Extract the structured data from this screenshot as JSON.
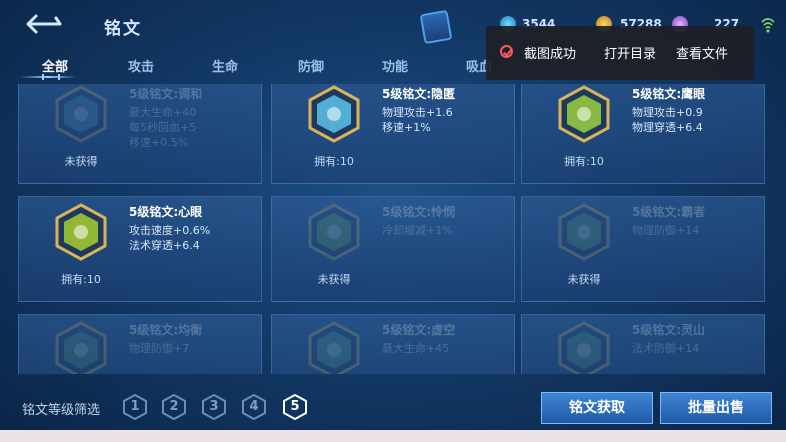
{
  "header": {
    "title": "铭文",
    "resources": {
      "gem": "3544",
      "gold": "57288",
      "crystal": "227"
    }
  },
  "tabs": [
    {
      "label": "全部",
      "active": true
    },
    {
      "label": "攻击"
    },
    {
      "label": "生命"
    },
    {
      "label": "防御"
    },
    {
      "label": "功能"
    },
    {
      "label": "吸血"
    }
  ],
  "toast": {
    "message": "截图成功",
    "open_dir": "打开目录",
    "view_file": "查看文件"
  },
  "cards": [
    {
      "name": "5级铭文:调和",
      "stats": [
        "最大生命+40",
        "每5秒回血+5",
        "移速+0.5%"
      ],
      "owned": "未获得",
      "acquired": false,
      "color": "#4fa0c8"
    },
    {
      "name": "5级铭文:隐匿",
      "stats": [
        "物理攻击+1.6",
        "移速+1%"
      ],
      "owned": "拥有:10",
      "acquired": true,
      "color": "#5cc4e8"
    },
    {
      "name": "5级铭文:鹰眼",
      "stats": [
        "物理攻击+0.9",
        "物理穿透+6.4"
      ],
      "owned": "拥有:10",
      "acquired": true,
      "color": "#9ccf3f"
    },
    {
      "name": "5级铭文:心眼",
      "stats": [
        "攻击速度+0.6%",
        "法术穿透+6.4"
      ],
      "owned": "拥有:10",
      "acquired": true,
      "color": "#a6cf2e"
    },
    {
      "name": "5级铭文:怜悯",
      "stats": [
        "冷却缩减+1%"
      ],
      "owned": "未获得",
      "acquired": false,
      "color": "#7fb84a"
    },
    {
      "name": "5级铭文:霸者",
      "stats": [
        "物理防御+14"
      ],
      "owned": "未获得",
      "acquired": false,
      "color": "#6fae66"
    },
    {
      "name": "5级铭文:均衡",
      "stats": [
        "物理防御+7"
      ],
      "owned": "",
      "acquired": false,
      "color": "#5ca56e"
    },
    {
      "name": "5级铭文:虚空",
      "stats": [
        "最大生命+45"
      ],
      "owned": "",
      "acquired": false,
      "color": "#5bb38a"
    },
    {
      "name": "5级铭文:灵山",
      "stats": [
        "法术防御+14"
      ],
      "owned": "",
      "acquired": false,
      "color": "#5ea67a"
    }
  ],
  "filter": {
    "label": "铭文等级筛选",
    "levels": [
      "1",
      "2",
      "3",
      "4",
      "5"
    ],
    "selected": "5"
  },
  "buttons": {
    "get": "铭文获取",
    "sell": "批量出售"
  }
}
